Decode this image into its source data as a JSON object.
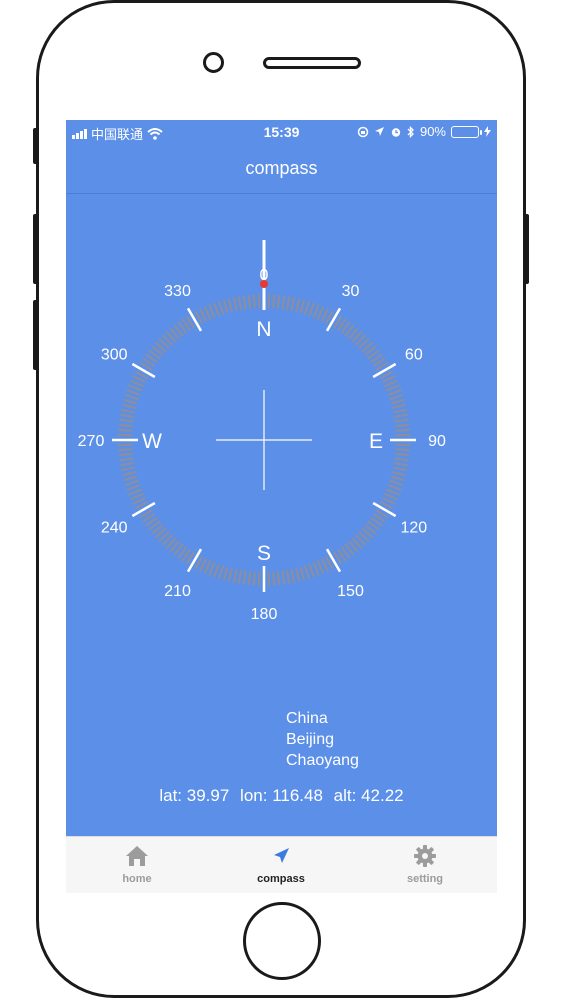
{
  "status_bar": {
    "carrier": "中国联通",
    "time": "15:39",
    "battery": "90%",
    "battery_level": 0.9
  },
  "nav": {
    "title": "compass"
  },
  "compass": {
    "heading": 0,
    "cardinals": {
      "N": "N",
      "E": "E",
      "S": "S",
      "W": "W"
    },
    "degree_labels": [
      "0",
      "30",
      "60",
      "90",
      "120",
      "150",
      "180",
      "210",
      "240",
      "270",
      "300",
      "330"
    ],
    "colors": {
      "needle_dot": "#e53935",
      "ring": "#8a8fa0",
      "marks": "#ffffff"
    }
  },
  "location": {
    "country": "China",
    "city": "Beijing",
    "district": "Chaoyang"
  },
  "coords": {
    "lat_label": "lat:",
    "lat": "39.97",
    "lon_label": "lon:",
    "lon": "116.48",
    "alt_label": "alt:",
    "alt": "42.22"
  },
  "tabs": [
    {
      "label": "home",
      "icon": "home-icon",
      "active": false
    },
    {
      "label": "compass",
      "icon": "navigation-arrow-icon",
      "active": true
    },
    {
      "label": "setting",
      "icon": "gear-icon",
      "active": false
    }
  ],
  "colors": {
    "screen_bg": "#5b8fe8",
    "tab_bg": "#f6f6f7",
    "active_tab_icon": "#3b7be0"
  }
}
